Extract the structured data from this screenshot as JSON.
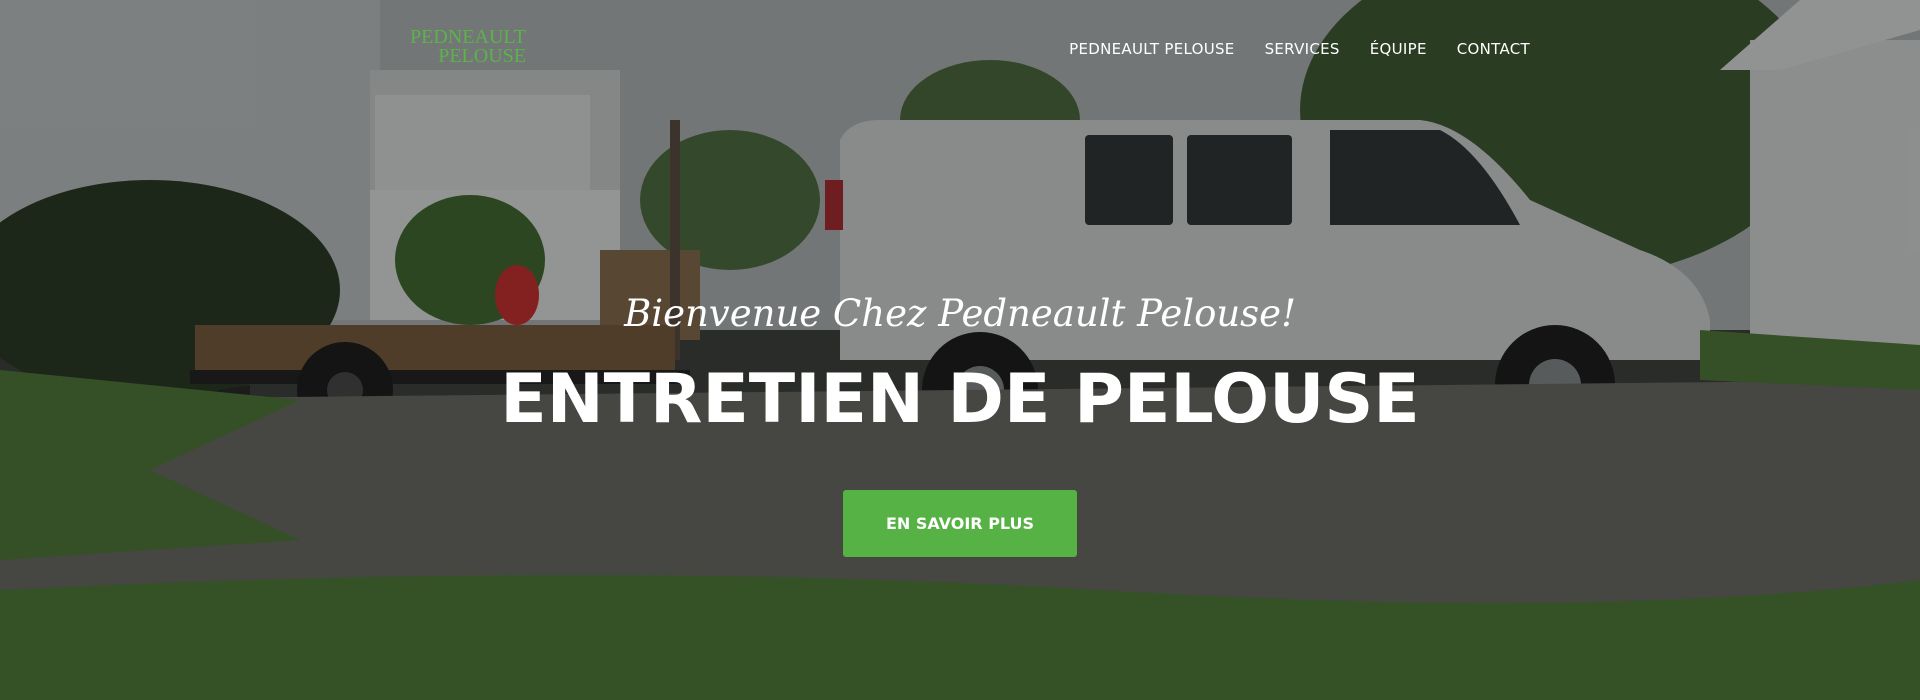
{
  "logo": {
    "line1": "PEDNEAULT",
    "line2": "PELOUSE"
  },
  "nav": {
    "items": [
      {
        "label": "PEDNEAULT PELOUSE"
      },
      {
        "label": "SERVICES"
      },
      {
        "label": "ÉQUIPE"
      },
      {
        "label": "CONTACT"
      }
    ]
  },
  "hero": {
    "welcome": "Bienvenue Chez Pedneault Pelouse!",
    "headline": "ENTRETIEN DE PELOUSE",
    "cta_label": "EN SAVOIR PLUS",
    "background_image": "white-van-trailer-driveway-photo"
  },
  "colors": {
    "accent": "#56b244",
    "logo": "#5bb349",
    "text": "#ffffff"
  }
}
